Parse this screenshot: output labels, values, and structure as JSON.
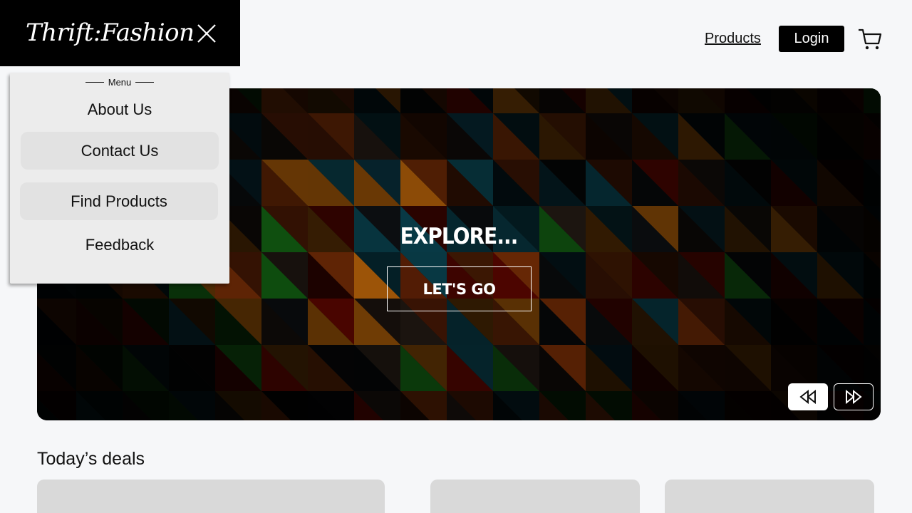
{
  "header": {
    "logo_text": "Thrift:Fashion",
    "close_icon": "close-icon",
    "nav_products": "Products",
    "login_label": "Login",
    "cart_icon": "cart-icon"
  },
  "menu": {
    "heading": "Menu",
    "items": [
      {
        "label": "About Us",
        "highlighted": false
      },
      {
        "label": "Contact Us",
        "highlighted": true
      },
      {
        "label": "Find Products",
        "highlighted": true
      },
      {
        "label": "Feedback",
        "highlighted": false
      }
    ]
  },
  "hero": {
    "title": "EXPLORE...",
    "cta_label": "LET'S GO",
    "prev_icon": "rewind-icon",
    "next_icon": "fast-forward-icon"
  },
  "deals": {
    "title": "Today’s deals",
    "card_count": 3
  },
  "colors": {
    "background": "#f6f7f9",
    "brand_bar": "#000000",
    "menu_bg": "#ececec",
    "menu_highlight": "#e2e2e2",
    "card_placeholder": "#d9d9d9"
  }
}
